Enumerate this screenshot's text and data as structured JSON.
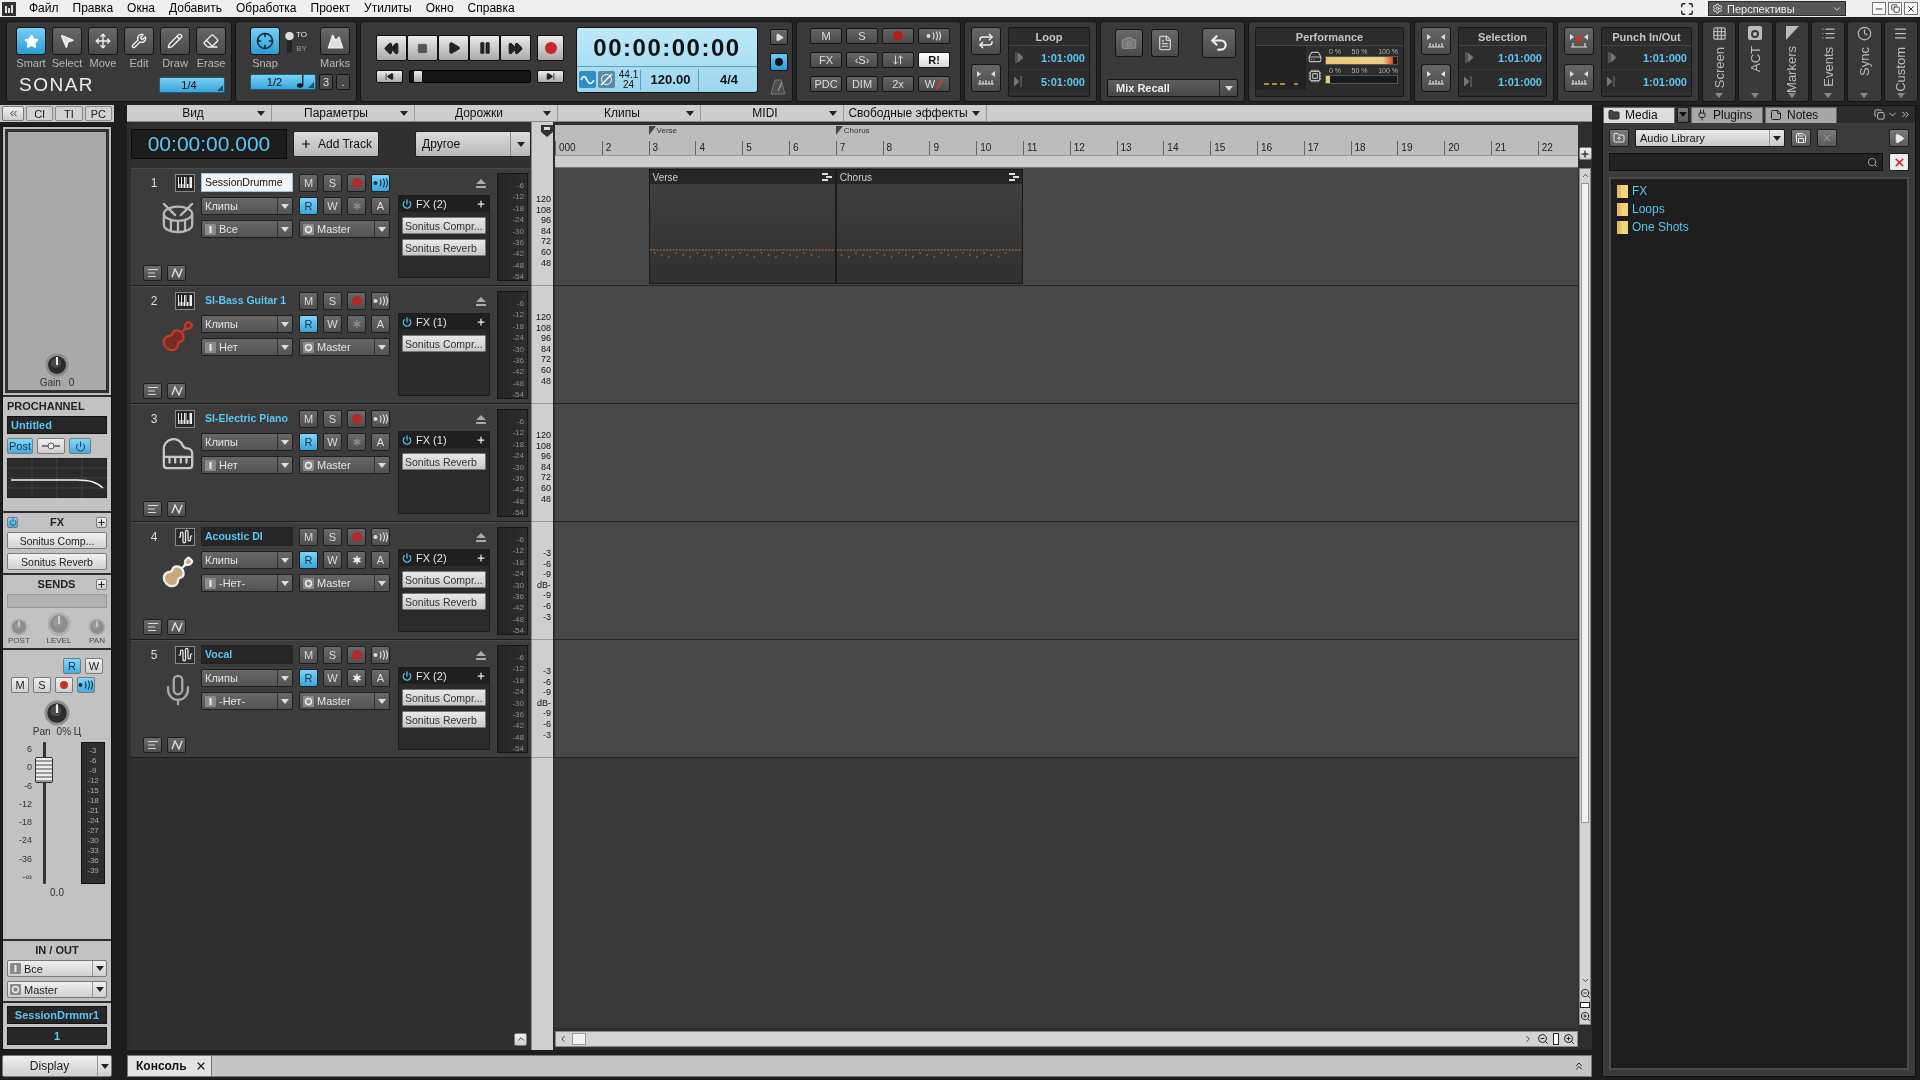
{
  "menu_bar": {
    "items": [
      "Файл",
      "Правка",
      "Окна",
      "Добавить",
      "Обработка",
      "Проект",
      "Утилиты",
      "Окно",
      "Справка"
    ],
    "perspectives": "Перспективы"
  },
  "control_bar": {
    "tools": [
      {
        "label": "Smart",
        "kind": "smart",
        "selected": true
      },
      {
        "label": "Select",
        "kind": "select",
        "selected": false
      },
      {
        "label": "Move",
        "kind": "move",
        "selected": false
      },
      {
        "label": "Edit",
        "kind": "edit",
        "selected": false
      },
      {
        "label": "Draw",
        "kind": "draw",
        "selected": false
      },
      {
        "label": "Erase",
        "kind": "erase",
        "selected": false
      }
    ],
    "logo": "SONAR",
    "tool_resolution": "1/4",
    "snap": {
      "label": "Snap",
      "on": true,
      "to": "TO",
      "by": "BY",
      "by_selected": false,
      "marks": "Marks",
      "resolution": "1/2",
      "triplet": "3",
      "dotted": "."
    },
    "transport": {
      "time": "00:00:00:00",
      "sample_rate": "44.1",
      "bit_depth": "24",
      "tempo": "120.00",
      "meter": "4/4",
      "scrub": {
        "level": 0.03
      }
    },
    "mix_buttons": [
      {
        "kind": "text",
        "label": "M",
        "on": false
      },
      {
        "kind": "text",
        "label": "S",
        "on": false
      },
      {
        "kind": "record",
        "on": false
      },
      {
        "kind": "echo",
        "on": false
      },
      {
        "kind": "text",
        "label": "FX",
        "on": false
      },
      {
        "kind": "text",
        "label": "‹S›",
        "on": false
      },
      {
        "kind": "arrows",
        "on": false
      },
      {
        "kind": "text",
        "label": "R!",
        "on": true
      },
      {
        "kind": "text",
        "label": "PDC",
        "on": false
      },
      {
        "kind": "text",
        "label": "DIM",
        "on": false
      },
      {
        "kind": "text",
        "label": "2x",
        "on": false
      },
      {
        "kind": "struck",
        "label": "W",
        "on": true
      }
    ],
    "loop": {
      "title": "Loop",
      "start": "1:01:000",
      "end": "5:01:000"
    },
    "mix_recall": {
      "label": "Mix Recall"
    },
    "performance": {
      "title": "Performance",
      "meters": [
        {
          "kind": "disk",
          "scale": [
            "0 %",
            "50 %",
            "100 %"
          ],
          "level": 0.95
        },
        {
          "kind": "cpu",
          "scale": [
            "0 %",
            "50 %",
            "100 %"
          ],
          "level": 0.06
        }
      ]
    },
    "selection": {
      "title": "Selection",
      "start": "1:01:000",
      "end": "1:01:000"
    },
    "punch": {
      "title": "Punch In/Out",
      "start": "1:01:000",
      "end": "1:01:000"
    },
    "view_tabs": [
      {
        "label": "Screen",
        "kind": "screen"
      },
      {
        "label": "ACT",
        "kind": "act"
      },
      {
        "label": "Markers",
        "kind": "markers"
      },
      {
        "label": "Events",
        "kind": "events"
      },
      {
        "label": "Sync",
        "kind": "sync"
      },
      {
        "label": "Custom",
        "kind": "custom"
      }
    ]
  },
  "inspector": {
    "tabs": [
      {
        "label": "CI",
        "selected": false
      },
      {
        "label": "TI",
        "selected": false
      },
      {
        "label": "PC",
        "selected": false
      }
    ],
    "gain": {
      "label": "Gain",
      "value": "0"
    },
    "prochannel": {
      "title": "PROCHANNEL",
      "preset": "Untitled",
      "post": {
        "label": "Post",
        "on": true
      },
      "power_on": true
    },
    "fx": {
      "title": "FX",
      "power_on": true,
      "plugins": [
        "Sonitus Comp...",
        "Sonitus Reverb"
      ]
    },
    "sends": {
      "title": "SENDS",
      "enabled": false,
      "knob_labels": [
        "POST",
        "LEVEL",
        "PAN"
      ]
    },
    "strip": {
      "read": {
        "label": "R",
        "on": true
      },
      "write": {
        "label": "W",
        "on": false
      },
      "mute": {
        "label": "M",
        "on": false
      },
      "solo": {
        "label": "S",
        "on": false
      },
      "armed": false,
      "input_echo": true,
      "pan_label": "Pan",
      "pan_value": "0% Ц",
      "fader_scale": [
        "6",
        "0",
        "-6",
        "-12",
        "-18",
        "-24",
        "-36",
        "-∞"
      ],
      "meter_scale": [
        "-3",
        "-6",
        "-9",
        "-12",
        "-15",
        "-18",
        "-21",
        "-24",
        "-27",
        "-30",
        "-33",
        "-36",
        "-39"
      ],
      "fader": {
        "level": 0.8
      },
      "volume": "0.0"
    },
    "in_out": {
      "title": "IN / OUT",
      "input": "Все",
      "output": "Master"
    },
    "track_name": "SessionDrmmr1",
    "track_number": "1",
    "display": "Display"
  },
  "track_view": {
    "menus": [
      "Вид",
      "Параметры",
      "Дорожки",
      "Клипы",
      "MIDI",
      "Свободные эффекты"
    ],
    "time": "00:00:00.000",
    "add_track": "Add Track",
    "filter": "Другое",
    "ruler": {
      "bars": [
        "000",
        "2",
        "3",
        "4",
        "5",
        "6",
        "7",
        "8",
        "9",
        "10",
        "11",
        "12",
        "13",
        "14",
        "15",
        "16",
        "17",
        "18",
        "19",
        "20",
        "21",
        "22"
      ],
      "markers": [
        {
          "label": "Verse"
        },
        {
          "label": "Chorus"
        }
      ]
    },
    "tracks": [
      {
        "number": "1",
        "kind": "midi",
        "name": "SessionDrumme",
        "editing": true,
        "instrument": {
          "kind": "drums"
        },
        "clips_mode": "Клипы",
        "input": "Все",
        "output": "Master",
        "mute": {
          "label": "M",
          "on": false
        },
        "solo": {
          "label": "S",
          "on": false
        },
        "armed": false,
        "input_echo": true,
        "read": {
          "label": "R",
          "on": true
        },
        "write": {
          "label": "W",
          "on": false
        },
        "asterisk_enabled": false,
        "archive": {
          "label": "A",
          "on": false
        },
        "fx": {
          "title": "FX (2)",
          "on": true,
          "plugins": [
            "Sonitus Compr...",
            "Sonitus Reverb"
          ]
        },
        "meter_scale": [
          "-6",
          "-12",
          "-18",
          "-24",
          "-30",
          "-36",
          "-42",
          "-48",
          "-54"
        ],
        "lane_scale": [
          "120",
          "108",
          "96",
          "84",
          "72",
          "60",
          "48"
        ],
        "clips": [
          {
            "name": "Verse"
          },
          {
            "name": "Chorus"
          }
        ]
      },
      {
        "number": "2",
        "kind": "midi",
        "name": "SI-Bass Guitar 1",
        "editing": false,
        "instrument": {
          "kind": "bass_guitar"
        },
        "clips_mode": "Клипы",
        "input": "Нет",
        "output": "Master",
        "mute": {
          "label": "M",
          "on": false
        },
        "solo": {
          "label": "S",
          "on": false
        },
        "armed": false,
        "input_echo": false,
        "read": {
          "label": "R",
          "on": true
        },
        "write": {
          "label": "W",
          "on": false
        },
        "asterisk_enabled": false,
        "archive": {
          "label": "A",
          "on": false
        },
        "fx": {
          "title": "FX (1)",
          "on": true,
          "plugins": [
            "Sonitus Compr..."
          ]
        },
        "meter_scale": [
          "-6",
          "-12",
          "-18",
          "-24",
          "-30",
          "-36",
          "-42",
          "-48",
          "-54"
        ],
        "lane_scale": [
          "120",
          "108",
          "96",
          "84",
          "72",
          "60",
          "48"
        ]
      },
      {
        "number": "3",
        "kind": "midi",
        "name": "SI-Electric Piano",
        "editing": false,
        "instrument": {
          "kind": "electric_piano"
        },
        "clips_mode": "Клипы",
        "input": "Нет",
        "output": "Master",
        "mute": {
          "label": "M",
          "on": false
        },
        "solo": {
          "label": "S",
          "on": false
        },
        "armed": false,
        "input_echo": false,
        "read": {
          "label": "R",
          "on": true
        },
        "write": {
          "label": "W",
          "on": false
        },
        "asterisk_enabled": false,
        "archive": {
          "label": "A",
          "on": false
        },
        "fx": {
          "title": "FX (1)",
          "on": true,
          "plugins": [
            "Sonitus Reverb"
          ]
        },
        "meter_scale": [
          "-6",
          "-12",
          "-18",
          "-24",
          "-30",
          "-36",
          "-42",
          "-48",
          "-54"
        ],
        "lane_scale": [
          "120",
          "108",
          "96",
          "84",
          "72",
          "60",
          "48"
        ]
      },
      {
        "number": "4",
        "kind": "audio",
        "name": "Acoustic DI",
        "editing": false,
        "instrument": {
          "kind": "acoustic_guitar"
        },
        "clips_mode": "Клипы",
        "input": "-Нет-",
        "output": "Master",
        "mute": {
          "label": "M",
          "on": false
        },
        "solo": {
          "label": "S",
          "on": false
        },
        "armed": false,
        "input_echo": false,
        "read": {
          "label": "R",
          "on": true
        },
        "write": {
          "label": "W",
          "on": false
        },
        "asterisk_enabled": true,
        "archive": {
          "label": "A",
          "on": false
        },
        "fx": {
          "title": "FX (2)",
          "on": true,
          "plugins": [
            "Sonitus Compr...",
            "Sonitus Reverb"
          ]
        },
        "meter_scale": [
          "-6",
          "-12",
          "-18",
          "-24",
          "-30",
          "-36",
          "-42",
          "-48",
          "-54"
        ],
        "lane_scale": [
          "-3",
          "-6",
          "-9",
          "dB-",
          "-9",
          "-6",
          "-3"
        ]
      },
      {
        "number": "5",
        "kind": "audio",
        "name": "Vocal",
        "editing": false,
        "instrument": {
          "kind": "microphone"
        },
        "clips_mode": "Клипы",
        "input": "-Нет-",
        "output": "Master",
        "mute": {
          "label": "M",
          "on": false
        },
        "solo": {
          "label": "S",
          "on": false
        },
        "armed": false,
        "input_echo": false,
        "read": {
          "label": "R",
          "on": true
        },
        "write": {
          "label": "W",
          "on": false
        },
        "asterisk_enabled": true,
        "archive": {
          "label": "A",
          "on": false
        },
        "fx": {
          "title": "FX (2)",
          "on": true,
          "plugins": [
            "Sonitus Compr...",
            "Sonitus Reverb"
          ]
        },
        "meter_scale": [
          "-6",
          "-12",
          "-18",
          "-24",
          "-30",
          "-36",
          "-42",
          "-48",
          "-54"
        ],
        "lane_scale": [
          "-3",
          "-6",
          "-9",
          "dB-",
          "-9",
          "-6",
          "-3"
        ]
      }
    ]
  },
  "browser": {
    "tabs": [
      {
        "label": "Media",
        "selected": true
      },
      {
        "label": "Plugins",
        "selected": false
      },
      {
        "label": "Notes",
        "selected": false
      }
    ],
    "library": "Audio Library",
    "items": [
      {
        "label": "FX"
      },
      {
        "label": "Loops"
      },
      {
        "label": "One Shots"
      }
    ]
  },
  "console": {
    "tabs": [
      {
        "label": "Консоль"
      }
    ]
  }
}
